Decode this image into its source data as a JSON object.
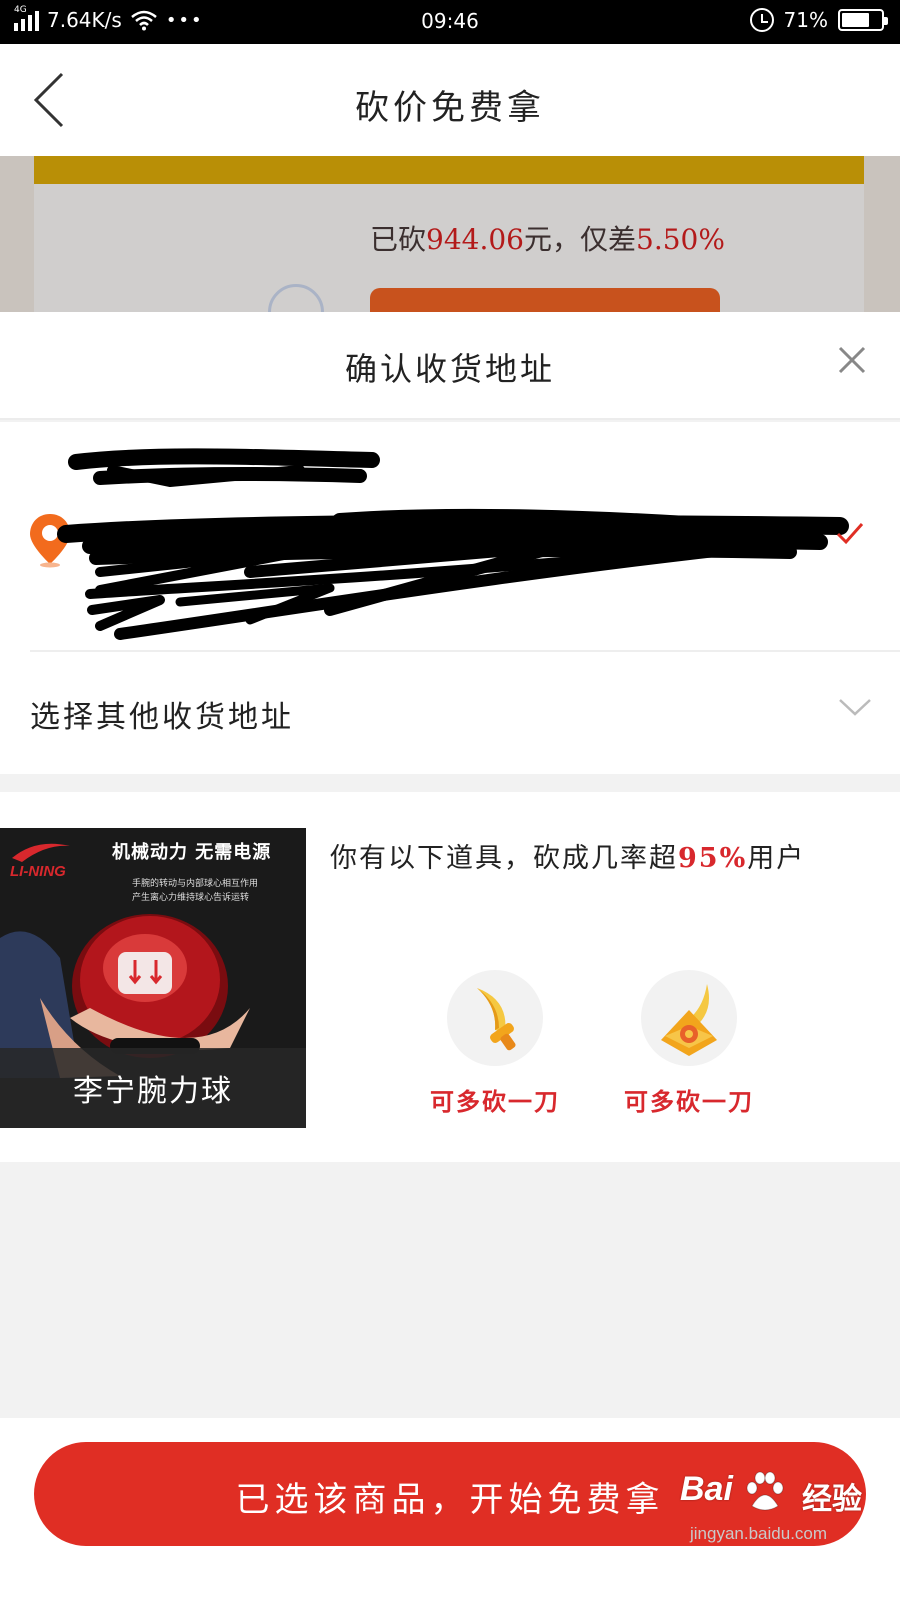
{
  "status_bar": {
    "network_type": "4G",
    "speed": "7.64K/s",
    "more": "•••",
    "time": "09:46",
    "battery_percent": "71%",
    "battery_level": 0.71
  },
  "nav": {
    "title": "砍价免费拿"
  },
  "background_card": {
    "progress_prefix": "已砍",
    "amount": "944.06",
    "middle": "元，仅差",
    "percent": "5.50%"
  },
  "sheet": {
    "title": "确认收货地址",
    "other_address_label": "选择其他收货地址",
    "product": {
      "image_caption": "李宁腕力球",
      "image_brand": "LI-NING",
      "image_slogan": "机械动力 无需电源",
      "image_sub1": "手腕的转动与内部球心相互作用",
      "image_sub2": "产生离心力维持球心告诉运转"
    },
    "tools": {
      "intro_prefix": "你有以下道具，砍成几率超",
      "intro_percent": "95%",
      "intro_suffix": "用户",
      "items": [
        {
          "label": "可多砍一刀",
          "icon": "golden-sword-icon"
        },
        {
          "label": "可多砍一刀",
          "icon": "golden-shuriken-icon"
        }
      ]
    },
    "cta_label": "已选该商品，开始免费拿"
  },
  "watermark": {
    "logo": "Bai",
    "logo_suffix": "经验",
    "url": "jingyan.baidu.com"
  },
  "colors": {
    "accent_red": "#e02e24",
    "highlight_red": "#d8282d",
    "pin_orange": "#f26b1d"
  }
}
